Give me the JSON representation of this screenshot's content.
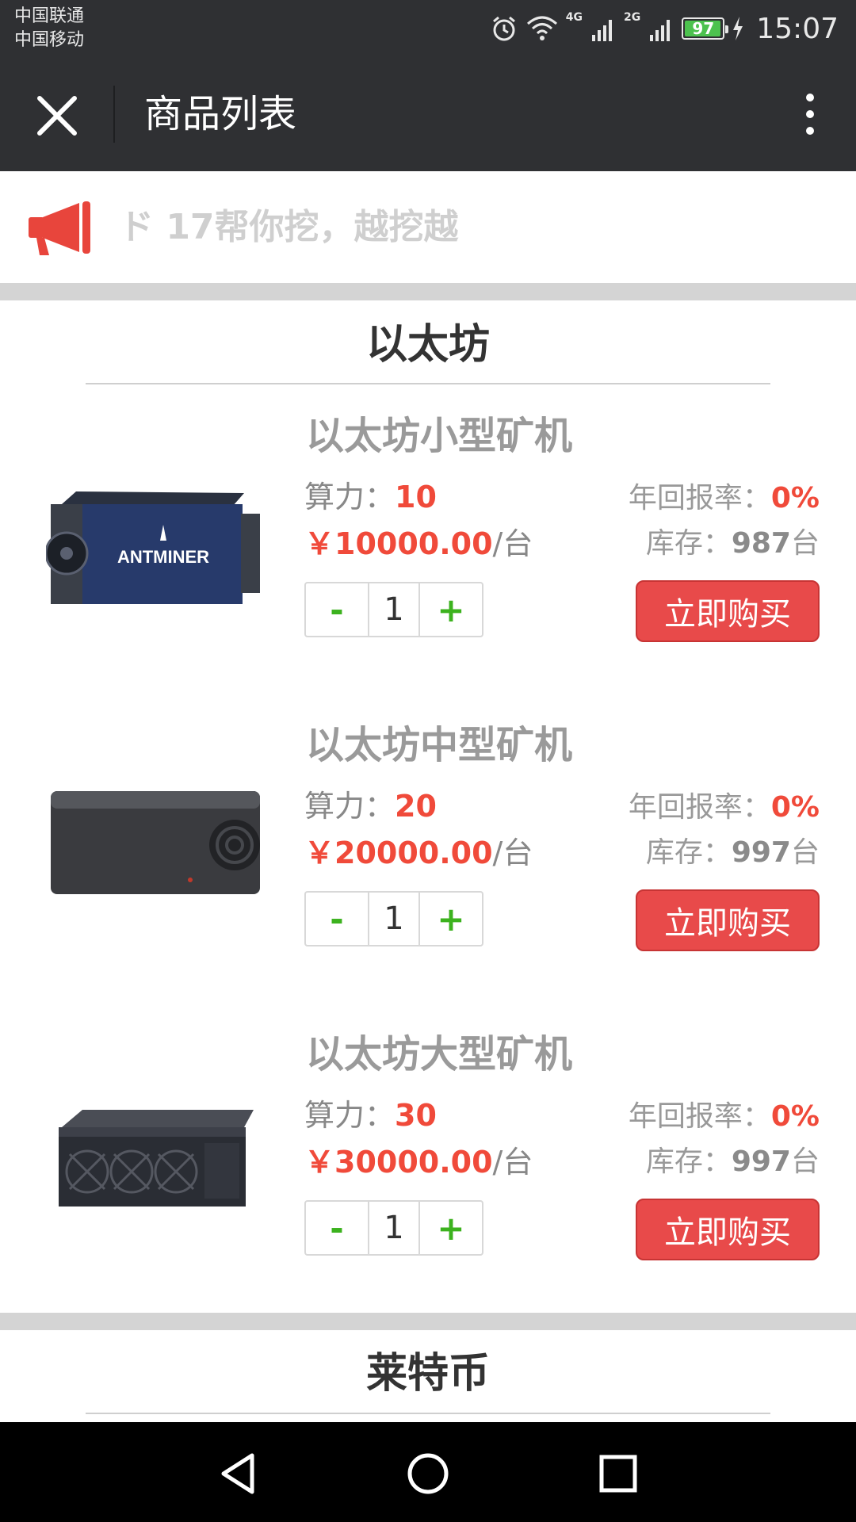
{
  "status_bar": {
    "carrier_1": "中国联通",
    "carrier_2": "中国移动",
    "net_1": "4G",
    "net_2": "2G",
    "battery": "97",
    "time": "15:07",
    "icons": [
      "alarm-icon",
      "wifi-icon",
      "signal-icon",
      "signal-icon",
      "battery-icon",
      "charging-icon"
    ]
  },
  "header": {
    "title": "商品列表",
    "close_icon": "close-icon",
    "more_icon": "more-vertical-icon"
  },
  "notice": {
    "icon": "megaphone-icon",
    "text": "ド      17帮你挖，越挖越"
  },
  "colors": {
    "accent": "#f04a3a",
    "buy_button": "#e84a4a",
    "stepper_green": "#3cb21e",
    "bar_dark": "#2f3033"
  },
  "categories": [
    {
      "title": "以太坊",
      "products": [
        {
          "name": "以太坊小型矿机",
          "power_label": "算力：",
          "power": "10",
          "price": "￥10000.00",
          "unit": "/台",
          "rate_label": "年回报率：",
          "rate": "0%",
          "stock_label": "库存：",
          "stock": "987",
          "stock_unit": "台",
          "minus": "-",
          "qty": "1",
          "plus": "+",
          "buy": "立即购买"
        },
        {
          "name": "以太坊中型矿机",
          "power_label": "算力：",
          "power": "20",
          "price": "￥20000.00",
          "unit": "/台",
          "rate_label": "年回报率：",
          "rate": "0%",
          "stock_label": "库存：",
          "stock": "997",
          "stock_unit": "台",
          "minus": "-",
          "qty": "1",
          "plus": "+",
          "buy": "立即购买"
        },
        {
          "name": "以太坊大型矿机",
          "power_label": "算力：",
          "power": "30",
          "price": "￥30000.00",
          "unit": "/台",
          "rate_label": "年回报率：",
          "rate": "0%",
          "stock_label": "库存：",
          "stock": "997",
          "stock_unit": "台",
          "minus": "-",
          "qty": "1",
          "plus": "+",
          "buy": "立即购买"
        }
      ]
    },
    {
      "title": "莱特币"
    }
  ],
  "navbar": {
    "back_icon": "back-triangle-icon",
    "home_icon": "home-circle-icon",
    "recent_icon": "recent-square-icon"
  }
}
